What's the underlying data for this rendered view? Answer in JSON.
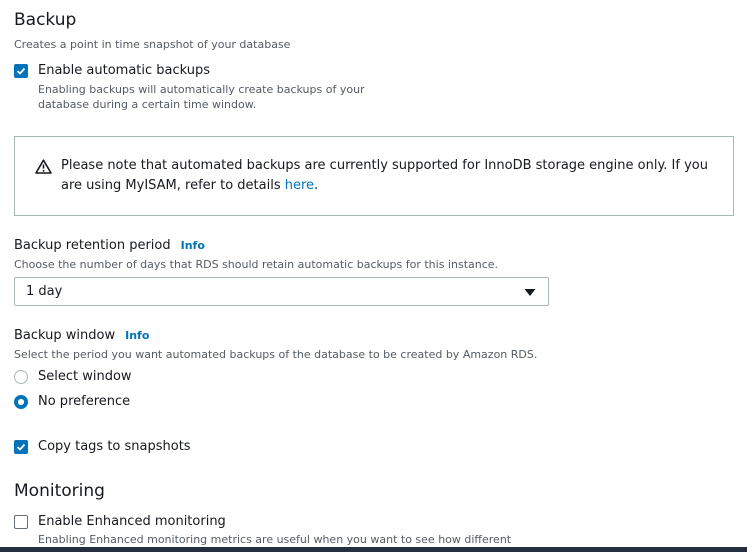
{
  "backup": {
    "title": "Backup",
    "description": "Creates a point in time snapshot of your database",
    "auto_backup": {
      "label": "Enable automatic backups",
      "checked": true,
      "help_line1": "Enabling backups will automatically create backups of your",
      "help_line2": "database during a certain time window."
    },
    "alert": {
      "line1": "Please note that automated backups are currently supported for InnoDB storage engine only. If you",
      "line2_prefix": "are using MyISAM, refer to details ",
      "link_text": "here",
      "line2_suffix": ".",
      "icon": "warning-icon"
    },
    "retention": {
      "label": "Backup retention period",
      "info": "Info",
      "description": "Choose the number of days that RDS should retain automatic backups for this instance.",
      "selected_value": "1 day"
    },
    "window": {
      "label": "Backup window",
      "info": "Info",
      "description": "Select the period you want automated backups of the database to be created by Amazon RDS.",
      "options": [
        {
          "label": "Select window",
          "selected": false
        },
        {
          "label": "No preference",
          "selected": true
        }
      ]
    },
    "copy_tags": {
      "label": "Copy tags to snapshots",
      "checked": true
    }
  },
  "monitoring": {
    "title": "Monitoring",
    "enhanced": {
      "label": "Enable Enhanced monitoring",
      "checked": false,
      "help": "Enabling Enhanced monitoring metrics are useful when you want to see how different"
    }
  },
  "colors": {
    "accent": "#0073bb",
    "text": "#16191f",
    "secondary_text": "#545b64",
    "border": "#aab7b8",
    "bottom_bar": "#232f3e"
  }
}
